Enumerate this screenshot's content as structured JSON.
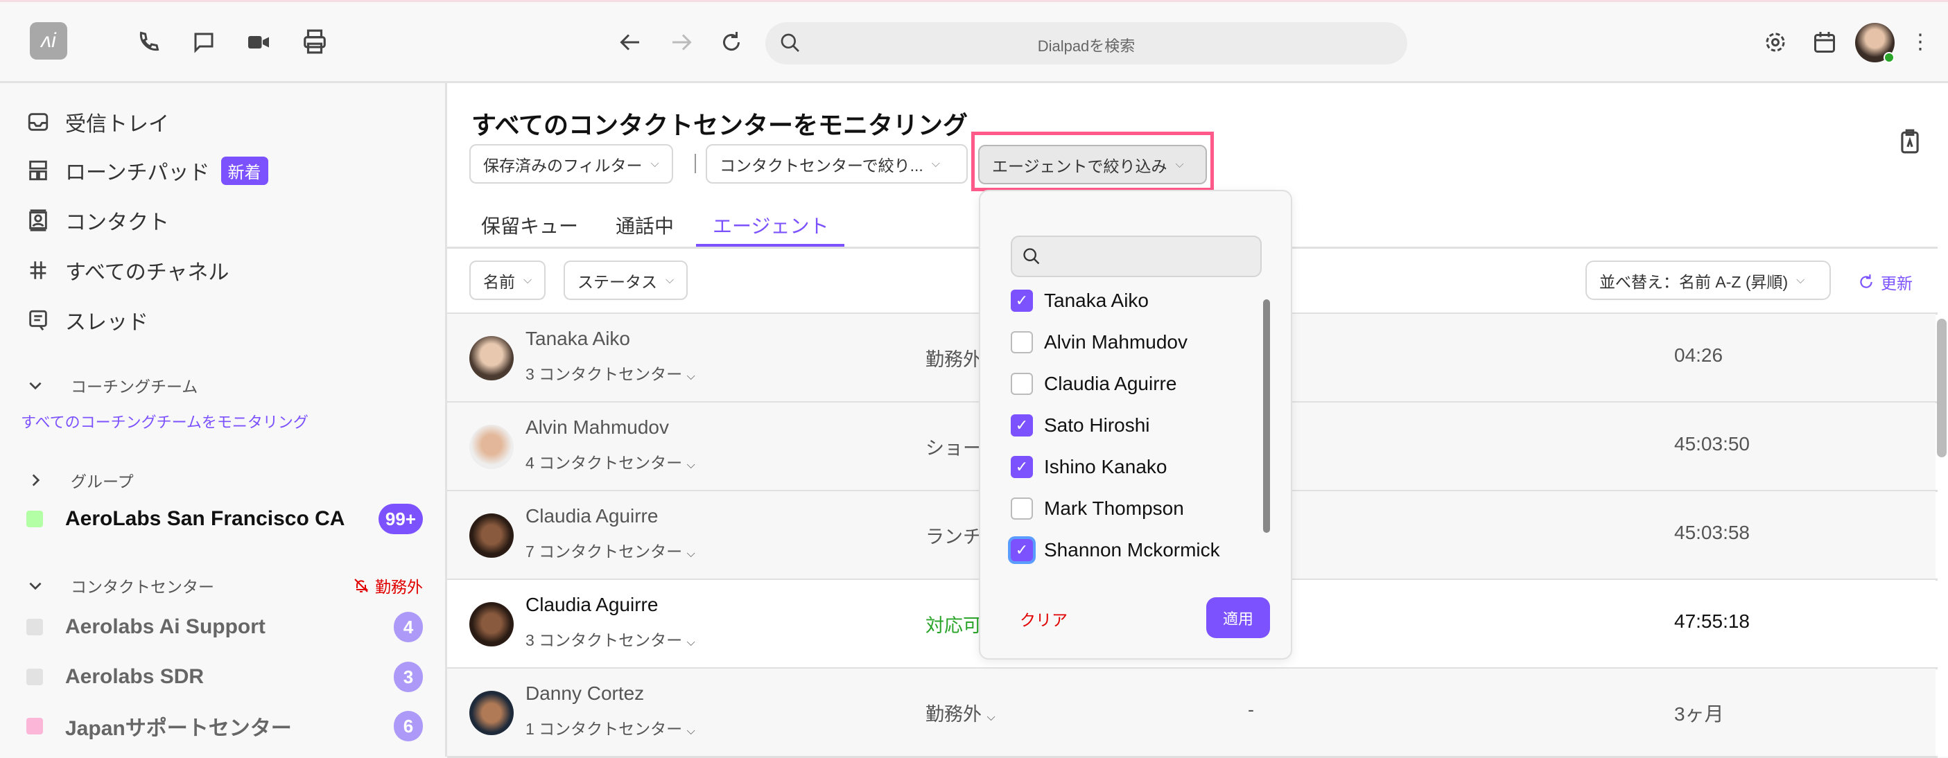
{
  "topbar": {
    "search_placeholder": "Dialpadを検索",
    "icons": [
      "app-logo",
      "phone-icon",
      "chat-icon",
      "video-icon",
      "print-icon",
      "back-arrow-icon",
      "forward-arrow-icon",
      "reload-icon",
      "search-icon",
      "gear-icon",
      "calendar-icon",
      "avatar",
      "more-icon"
    ]
  },
  "sidebar": {
    "items": [
      {
        "label": "受信トレイ",
        "icon": "inbox-icon"
      },
      {
        "label": "ローンチパッド",
        "icon": "launchpad-icon",
        "badge": "新着"
      },
      {
        "label": "コンタクト",
        "icon": "contact-icon"
      },
      {
        "label": "すべてのチャネル",
        "icon": "hash-icon"
      },
      {
        "label": "スレッド",
        "icon": "thread-icon"
      }
    ],
    "coaching": {
      "label": "コーチングチーム",
      "link": "すべてのコーチングチームをモニタリング"
    },
    "groups": {
      "label": "グループ",
      "items": [
        {
          "name": "AeroLabs San Francisco CA",
          "count": "99+",
          "color": "#b3ffa6"
        }
      ]
    },
    "contact_centers": {
      "label": "コンタクトセンター",
      "status": "勤務外",
      "items": [
        {
          "name": "Aerolabs Ai Support",
          "count": "4",
          "color": "#e2e2e2"
        },
        {
          "name": "Aerolabs SDR",
          "count": "3",
          "color": "#e2e2e2"
        },
        {
          "name": "Japanサポートセンター",
          "count": "6",
          "color": "#fbb6d8"
        }
      ]
    }
  },
  "main": {
    "title": "すべてのコンタクトセンターをモニタリング",
    "filters": {
      "saved": "保存済みのフィルター",
      "contact_center": "コンタクトセンターで絞り...",
      "agent": "エージェントで絞り込み"
    },
    "tabs": [
      {
        "label": "保留キュー"
      },
      {
        "label": "通話中"
      },
      {
        "label": "エージェント",
        "active": true
      }
    ],
    "subfilters": {
      "name": "名前",
      "status": "ステータス",
      "sort": "並べ替え：名前 A-Z (昇順)",
      "refresh": "更新"
    },
    "rows": [
      {
        "name": "Tanaka Aiko",
        "centers": "3 コンタクトセンター",
        "status": "勤務外",
        "time": "04:26"
      },
      {
        "name": "Alvin Mahmudov",
        "centers": "4 コンタクトセンター",
        "status": "ショー",
        "time": "45:03:50"
      },
      {
        "name": "Claudia Aguirre",
        "centers": "7 コンタクトセンター",
        "status": "ランチ",
        "time": "45:03:58"
      },
      {
        "name": "Claudia Aguirre",
        "centers": "3 コンタクトセンター",
        "status": "対応可",
        "time": "47:55:18",
        "highlight": true
      },
      {
        "name": "Danny Cortez",
        "centers": "1 コンタクトセンター",
        "status": "勤務外",
        "dash": "-",
        "time": "3ヶ月"
      }
    ]
  },
  "dropdown": {
    "options": [
      {
        "label": "Tanaka Aiko",
        "checked": true
      },
      {
        "label": "Alvin Mahmudov",
        "checked": false
      },
      {
        "label": "Claudia Aguirre",
        "checked": false
      },
      {
        "label": "Sato Hiroshi",
        "checked": true
      },
      {
        "label": "Ishino Kanako",
        "checked": true
      },
      {
        "label": "Mark Thompson",
        "checked": false
      },
      {
        "label": "Shannon Mckormick",
        "checked": true
      }
    ],
    "clear": "クリア",
    "apply": "適用"
  },
  "colors": {
    "accent": "#7c52ff",
    "highlight_box": "#ff5a8a",
    "available": "#2aa52a",
    "danger": "#e00000"
  }
}
